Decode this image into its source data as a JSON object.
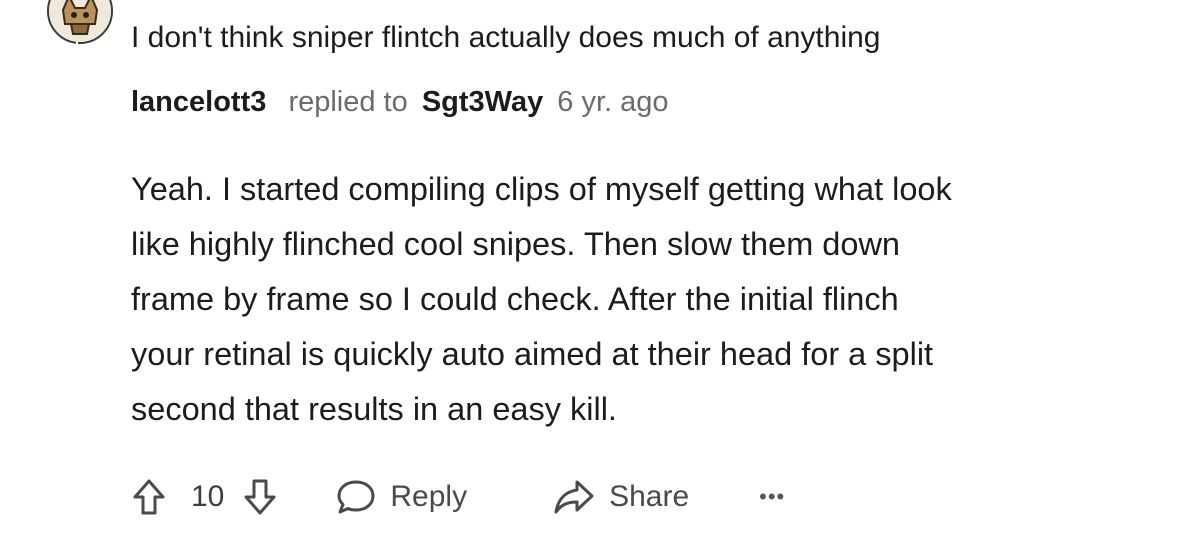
{
  "parent_comment": {
    "text": "I don't think sniper flintch actually does much of anything"
  },
  "reply": {
    "author": "lancelott3",
    "replied_to_label": "replied to",
    "parent_author": "Sgt3Way",
    "age": "6 yr. ago",
    "body_lines": [
      "Yeah. I started compiling clips of myself getting what look",
      "like highly flinched cool snipes. Then slow them down",
      "frame by frame so I could check. After the initial flinch",
      "your retinal is quickly auto aimed at their head for a split",
      "second that results in an easy kill."
    ]
  },
  "actions": {
    "score": "10",
    "reply_label": "Reply",
    "share_label": "Share",
    "more_label": "•••"
  },
  "icons": {
    "upvote": "upvote-arrow-icon",
    "downvote": "downvote-arrow-icon",
    "reply": "comment-bubble-icon",
    "share": "share-arrow-icon"
  },
  "colors": {
    "text": "#1c1c1c",
    "muted": "#6b6b6b",
    "icon": "#4a4a4a"
  }
}
